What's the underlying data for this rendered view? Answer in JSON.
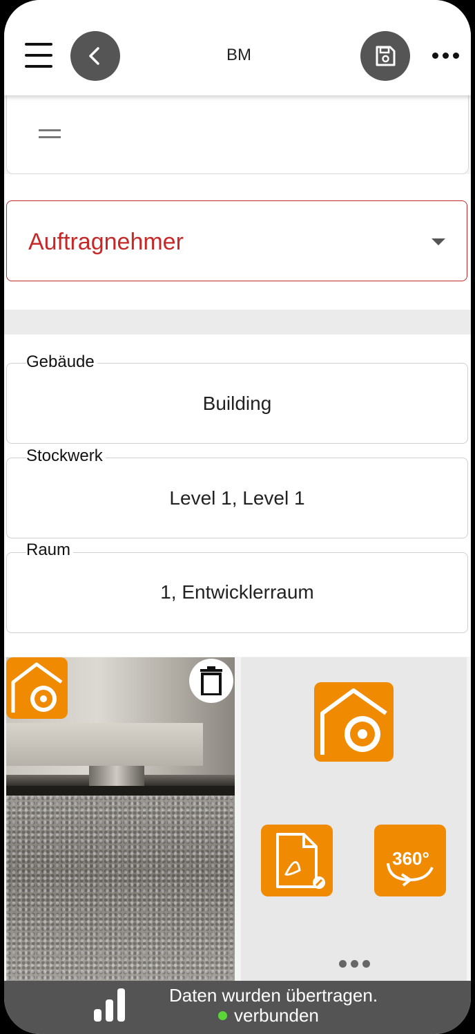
{
  "header": {
    "title": "BM",
    "menu_icon": "hamburger-menu-icon",
    "back_icon": "chevron-left-icon",
    "save_icon": "floppy-disk-icon",
    "more_icon": "more-horizontal-icon"
  },
  "top_card": {
    "icon": "drag-handle-icon"
  },
  "dropdown": {
    "label": "Auftragnehmer",
    "color": "#c62828"
  },
  "fields": {
    "building": {
      "label": "Gebäude",
      "value": "Building"
    },
    "level": {
      "label": "Stockwerk",
      "value": "Level 1, Level 1"
    },
    "room": {
      "label": "Raum",
      "value": "1, Entwicklerraum"
    }
  },
  "photo": {
    "badge_icon": "house-camera-icon",
    "delete_icon": "trash-icon"
  },
  "actions": {
    "camera_icon": "house-camera-icon",
    "pdf_icon": "pdf-export-icon",
    "panorama_icon": "360-view-icon",
    "more_icon": "more-horizontal-icon",
    "panorama_text": "360°",
    "accent_color": "#f08a00"
  },
  "status": {
    "line1": "Daten wurden übertragen.",
    "line2": "verbunden",
    "signal_icon": "signal-bars-icon",
    "connected_color": "#5bd638"
  }
}
